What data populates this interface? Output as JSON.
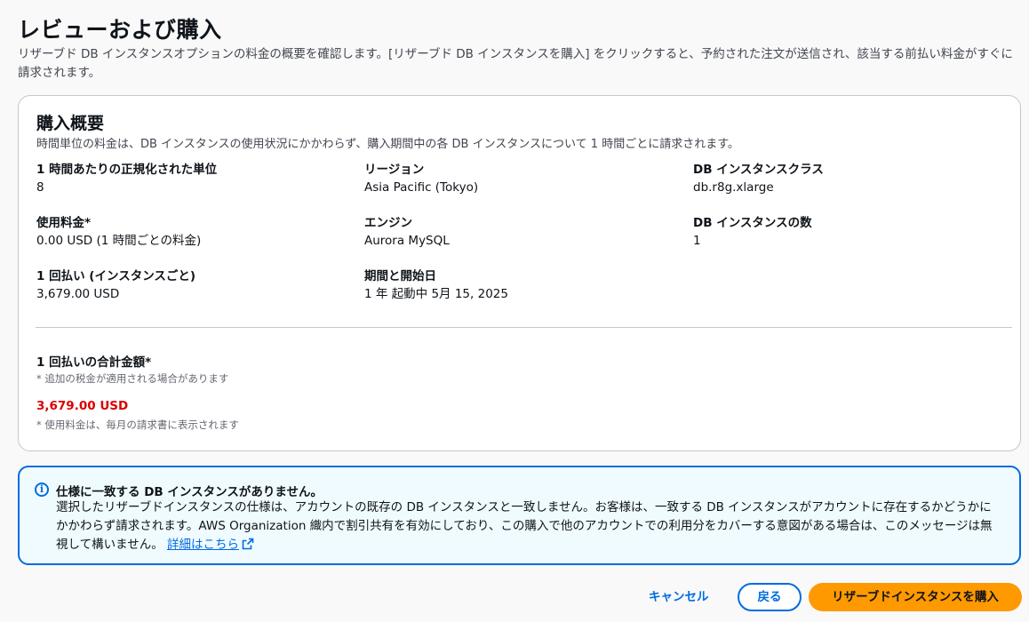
{
  "page": {
    "title": "レビューおよび購入",
    "description": "リザーブド DB インスタンスオプションの料金の概要を確認します。[リザーブド DB インスタンスを購入] をクリックすると、予約された注文が送信され、該当する前払い料金がすぐに請求されます。"
  },
  "summary": {
    "title": "購入概要",
    "description": "時間単位の料金は、DB インスタンスの使用状況にかかわらず、購入期間中の各 DB インスタンスについて 1 時間ごとに請求されます。",
    "fields": [
      {
        "label": "1 時間あたりの正規化された単位",
        "value": "8"
      },
      {
        "label": "リージョン",
        "value": "Asia Pacific (Tokyo)"
      },
      {
        "label": "DB インスタンスクラス",
        "value": "db.r8g.xlarge"
      },
      {
        "label": "使用料金*",
        "value": "0.00 USD (1 時間ごとの料金)"
      },
      {
        "label": "エンジン",
        "value": "Aurora MySQL"
      },
      {
        "label": "DB インスタンスの数",
        "value": "1"
      },
      {
        "label": "1 回払い (インスタンスごと)",
        "value": "3,679.00 USD"
      },
      {
        "label": "期間と開始日",
        "value": "1 年 起動中 5月 15, 2025"
      }
    ],
    "total": {
      "label": "1 回払いの合計金額*",
      "tax_note": "* 追加の税金が適用される場合があります",
      "amount": "3,679.00 USD",
      "usage_note": "* 使用料金は、毎月の請求書に表示されます"
    }
  },
  "alert": {
    "icon": "info-icon",
    "title": "仕様に一致する DB インスタンスがありません。",
    "body": "選択したリザーブドインスタンスの仕様は、アカウントの既存の DB インスタンスと一致しません。お客様は、一致する DB インスタンスがアカウントに存在するかどうかにかかわらず請求されます。AWS Organization 織内で割引共有を有効にしており、この購入で他のアカウントでの利用分をカバーする意図がある場合は、このメッセージは無視して構いません。",
    "link": "詳細はこちら"
  },
  "actions": {
    "cancel": "キャンセル",
    "back": "戻る",
    "purchase": "リザーブドインスタンスを購入"
  },
  "colors": {
    "accent": "#006ce0",
    "primary_button": "#ff9900",
    "total_amount": "#db0000",
    "alert_background": "#f0fbff"
  }
}
